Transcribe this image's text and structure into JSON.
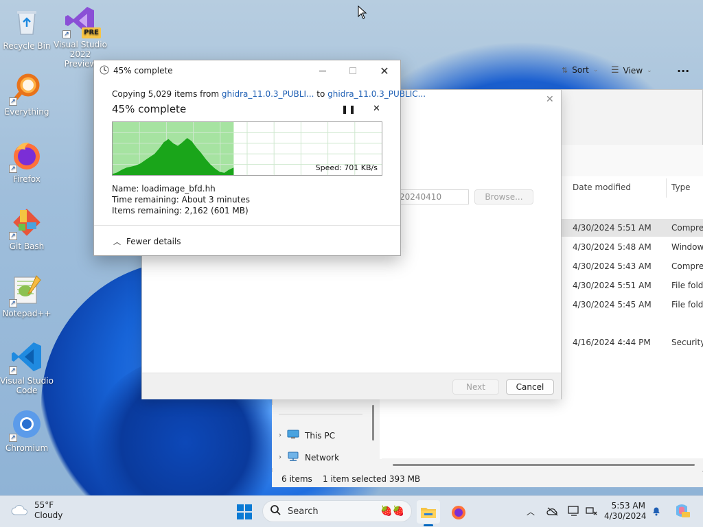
{
  "desktop": {
    "icons": [
      {
        "label": "Recycle Bin"
      },
      {
        "label": "Visual Studio 2022 Preview",
        "badge": "PRE"
      },
      {
        "label": "Everything"
      },
      {
        "label": "Firefox"
      },
      {
        "label": "Git Bash"
      },
      {
        "label": "Notepad++"
      },
      {
        "label": "Visual Studio Code"
      },
      {
        "label": "Chromium"
      }
    ]
  },
  "copy_dialog": {
    "title": "45% complete",
    "copy_prefix": "Copying 5,029 items from ",
    "source": "ghidra_11.0.3_PUBLI...",
    "to_word": " to ",
    "destination": "ghidra_11.0.3_PUBLIC...",
    "percent_text": "45% complete",
    "progress_percent": 45,
    "speed": "Speed: 701 KB/s",
    "name_label": "Name:",
    "name_value": "loadimage_bfd.hh",
    "time_label": "Time remaining:",
    "time_value": "About 3 minutes",
    "items_label": "Items remaining:",
    "items_value": "2,162 (601 MB)",
    "fewer_details": "Fewer details",
    "graph_fill": "#a6e3a1",
    "graph_line": "#1aa51a"
  },
  "wizard": {
    "path_value": "20240410",
    "browse_label": "Browse...",
    "next_label": "Next",
    "cancel_label": "Cancel"
  },
  "explorer": {
    "sort_label": "Sort",
    "view_label": "View",
    "more_label": "...",
    "columns": [
      "Date modified",
      "Type"
    ],
    "rows": [
      {
        "date": "4/30/2024 5:51 AM",
        "type": "Compres",
        "selected": true
      },
      {
        "date": "4/30/2024 5:48 AM",
        "type": "Windows",
        "selected": false
      },
      {
        "date": "4/30/2024 5:43 AM",
        "type": "Compres",
        "selected": false
      },
      {
        "date": "4/30/2024 5:51 AM",
        "type": "File folde",
        "selected": false
      },
      {
        "date": "4/30/2024 5:45 AM",
        "type": "File folde",
        "selected": false
      },
      {
        "date": "4/16/2024 4:44 PM",
        "type": "Security",
        "selected": false
      }
    ],
    "nav": [
      {
        "label": "This PC"
      },
      {
        "label": "Network"
      }
    ],
    "status_items": "6 items",
    "status_selected": "1 item selected  393 MB"
  },
  "taskbar": {
    "weather_temp": "55°F",
    "weather_desc": "Cloudy",
    "search_placeholder": "Search",
    "time": "5:53 AM",
    "date": "4/30/2024",
    "accent": "#0067c0"
  }
}
